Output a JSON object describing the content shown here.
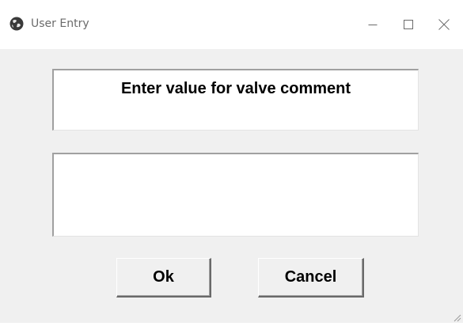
{
  "window": {
    "title": "User Entry",
    "caption_buttons": {
      "minimize": "minimize-icon",
      "maximize": "maximize-icon",
      "close": "close-icon"
    }
  },
  "dialog": {
    "prompt": "Enter value for valve comment",
    "entry_value": "",
    "ok_label": "Ok",
    "cancel_label": "Cancel"
  },
  "colors": {
    "dialog_bg": "#f0f0f0",
    "titlebar_bg": "#ffffff",
    "field_bg": "#ffffff"
  }
}
